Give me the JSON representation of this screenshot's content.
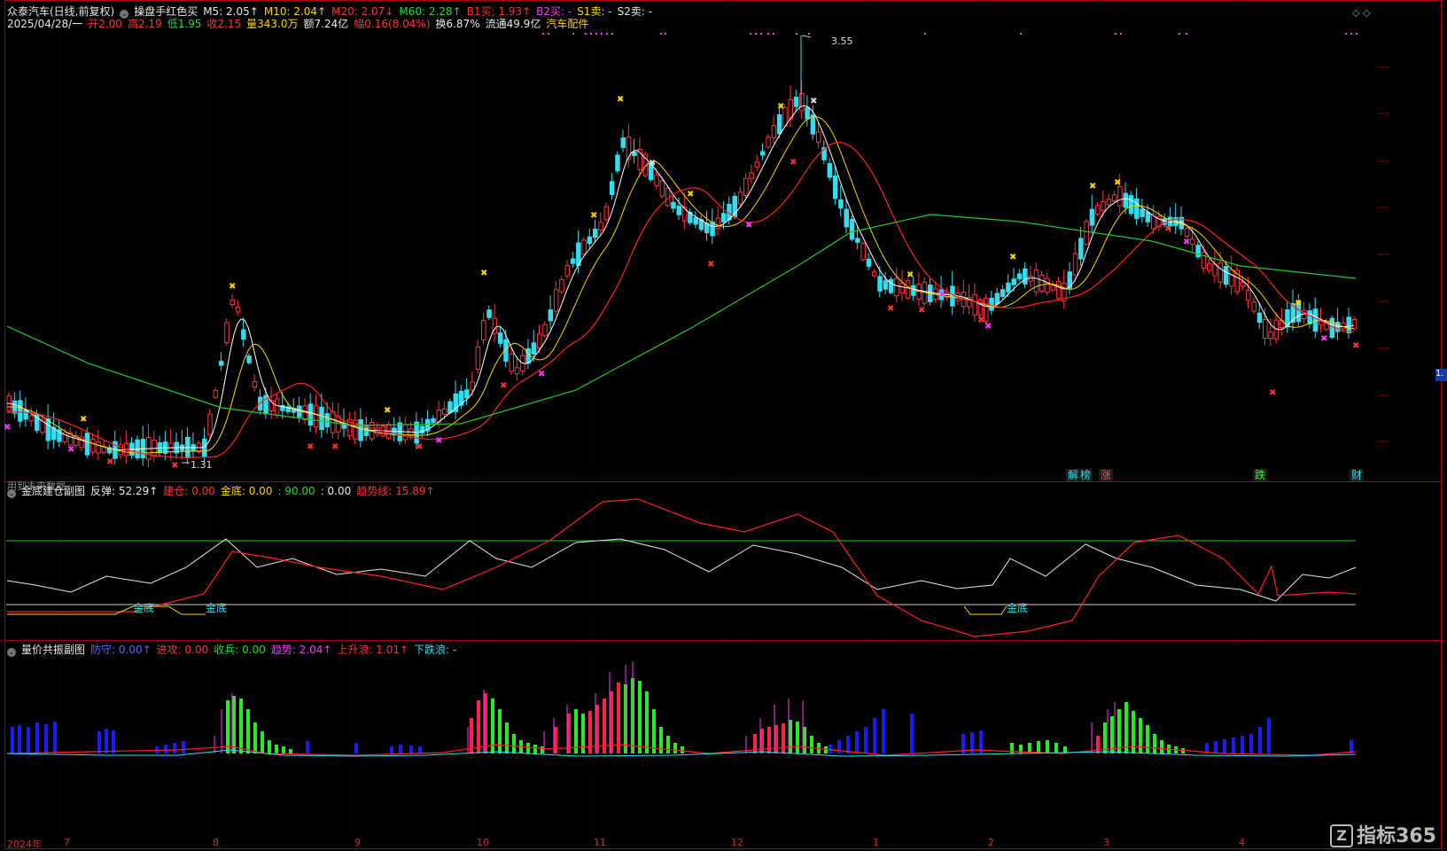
{
  "main_panel": {
    "line1": [
      {
        "text": "众泰汽车(日线,前复权)",
        "color": "w"
      },
      {
        "text": "操盘手红色买",
        "color": "w",
        "icon": true
      },
      {
        "text": "M5: 2.05↑",
        "color": "w"
      },
      {
        "text": "M10: 2.04↑",
        "color": "y"
      },
      {
        "text": "M20: 2.07↓",
        "color": "r"
      },
      {
        "text": "M60: 2.28↑",
        "color": "g"
      },
      {
        "text": "B1买: 1.93↑",
        "color": "r"
      },
      {
        "text": "B2买: -",
        "color": "m"
      },
      {
        "text": "S1卖: -",
        "color": "y"
      },
      {
        "text": "S2卖: -",
        "color": "w"
      }
    ],
    "line2": [
      {
        "text": "2025/04/28/一",
        "color": "w"
      },
      {
        "text": "开2.00",
        "color": "r"
      },
      {
        "text": "高2.19",
        "color": "r"
      },
      {
        "text": "低1.95",
        "color": "g"
      },
      {
        "text": "收2.15",
        "color": "r"
      },
      {
        "text": "量343.0万",
        "color": "y"
      },
      {
        "text": "额7.24亿",
        "color": "w"
      },
      {
        "text": "幅0.16(8.04%)",
        "color": "r"
      },
      {
        "text": "换6.87%",
        "color": "w"
      },
      {
        "text": "流通49.9亿",
        "color": "w"
      },
      {
        "text": "汽车配件",
        "color": "y"
      }
    ],
    "high_label": "3.55",
    "low_label": "1.31",
    "future_note": "用到未来数据",
    "price_tag": "1.",
    "event_tags": [
      {
        "text": "解",
        "color": "#33ddee"
      },
      {
        "text": "榜",
        "color": "#33ddee"
      },
      {
        "text": "涨",
        "color": "#ff5050"
      },
      {
        "text": "跌",
        "color": "#33ff33"
      },
      {
        "text": "财",
        "color": "#33ddee"
      }
    ]
  },
  "sub_panel1": {
    "items": [
      {
        "text": "金底建仓副图",
        "color": "w",
        "icon": true
      },
      {
        "text": "反弹: 52.29↑",
        "color": "w"
      },
      {
        "text": "建仓: 0.00",
        "color": "r"
      },
      {
        "text": "金底: 0.00",
        "color": "y"
      },
      {
        "text": ": 90.00",
        "color": "g"
      },
      {
        "text": ": 0.00",
        "color": "w"
      },
      {
        "text": "趋势线: 15.89↑",
        "color": "r"
      }
    ],
    "markers": [
      "金底",
      "金底",
      "金底"
    ]
  },
  "sub_panel2": {
    "items": [
      {
        "text": "量价共振副图",
        "color": "w",
        "icon": true
      },
      {
        "text": "防守: 0.00↑",
        "color": "b"
      },
      {
        "text": "进攻: 0.00",
        "color": "r"
      },
      {
        "text": "收兵: 0.00",
        "color": "g"
      },
      {
        "text": "趋势: 2.04↑",
        "color": "m"
      },
      {
        "text": "上升浪: 1.01↑",
        "color": "r"
      },
      {
        "text": "下跌浪: -",
        "color": "c"
      }
    ]
  },
  "x_axis": [
    "2024年",
    "7",
    "8",
    "9",
    "10",
    "11",
    "12",
    "1",
    "2",
    "3",
    "4"
  ],
  "logo_text": "指标365",
  "logo_mark": "Z",
  "colors": {
    "border": "#a00000",
    "up": "#ff3040",
    "down": "#33ddee",
    "ma5": "#ffffff",
    "ma10": "#ffd400",
    "ma20": "#ff2020",
    "ma60": "#22cc22"
  }
}
